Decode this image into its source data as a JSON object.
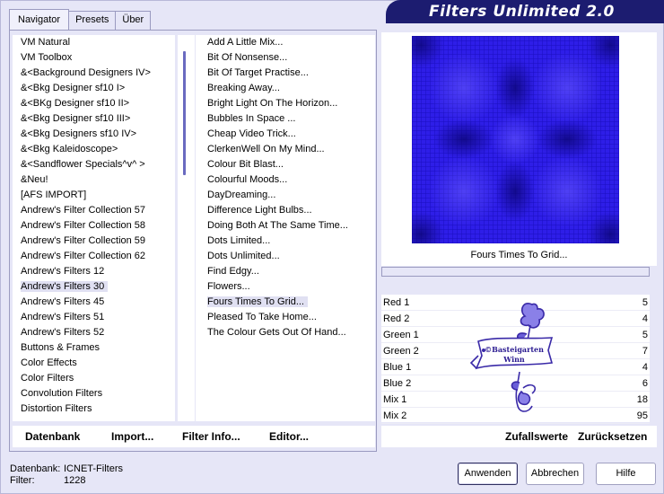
{
  "title": "Filters Unlimited 2.0",
  "tabs": [
    "Navigator",
    "Presets",
    "Über"
  ],
  "categories": [
    "VM Natural",
    "VM Toolbox",
    "&<Background Designers IV>",
    "&<Bkg Designer sf10 I>",
    "&<BKg Designer sf10 II>",
    "&<Bkg Designer sf10 III>",
    "&<Bkg Designers sf10 IV>",
    "&<Bkg Kaleidoscope>",
    "&<Sandflower Specials^v^ >",
    "&Neu!",
    "[AFS IMPORT]",
    "Andrew's Filter Collection 57",
    "Andrew's Filter Collection 58",
    "Andrew's Filter Collection 59",
    "Andrew's Filter Collection 62",
    "Andrew's Filters 12",
    "Andrew's Filters 30",
    "Andrew's Filters 45",
    "Andrew's Filters 51",
    "Andrew's Filters 52",
    "Buttons & Frames",
    "Color Effects",
    "Color Filters",
    "Convolution Filters",
    "Distortion Filters"
  ],
  "selected_category": "Andrew's Filters 30",
  "filters": [
    "Add A Little Mix...",
    "Bit Of Nonsense...",
    "Bit Of Target Practise...",
    "Breaking Away...",
    "Bright Light On The Horizon...",
    "Bubbles In Space ...",
    "Cheap Video Trick...",
    "ClerkenWell On My Mind...",
    "Colour Bit Blast...",
    "Colourful Moods...",
    "DayDreaming...",
    "Difference Light Bulbs...",
    "Doing Both At The Same Time...",
    "Dots Limited...",
    "Dots Unlimited...",
    "Find Edgy...",
    "Flowers...",
    "Fours Times To Grid...",
    "Pleased To Take Home...",
    "The Colour Gets Out Of Hand..."
  ],
  "selected_filter": "Fours Times To Grid...",
  "current_filter_name": "Fours Times To Grid...",
  "params": [
    {
      "name": "Red 1",
      "value": "5"
    },
    {
      "name": "Red 2",
      "value": "4"
    },
    {
      "name": "Green 1",
      "value": "5"
    },
    {
      "name": "Green 2",
      "value": "7"
    },
    {
      "name": "Blue 1",
      "value": "4"
    },
    {
      "name": "Blue 2",
      "value": "6"
    },
    {
      "name": "Mix 1",
      "value": "18"
    },
    {
      "name": "Mix 2",
      "value": "95"
    }
  ],
  "watermark_text": [
    "©Basteigarten",
    "Winn"
  ],
  "bottom_left": {
    "database": "Datenbank",
    "import": "Import...",
    "filter_info": "Filter Info...",
    "editor": "Editor..."
  },
  "bottom_right": {
    "random": "Zufallswerte",
    "reset": "Zurücksetzen"
  },
  "status": {
    "db_label": "Datenbank:",
    "db_value": "ICNET-Filters",
    "filter_label": "Filter:",
    "filter_value": "1228"
  },
  "buttons": {
    "apply": "Anwenden",
    "cancel": "Abbrechen",
    "help": "Hilfe"
  },
  "colors": {
    "banner": "#1c1c70",
    "preview": "#2a18e4",
    "background": "#e6e6f7"
  }
}
